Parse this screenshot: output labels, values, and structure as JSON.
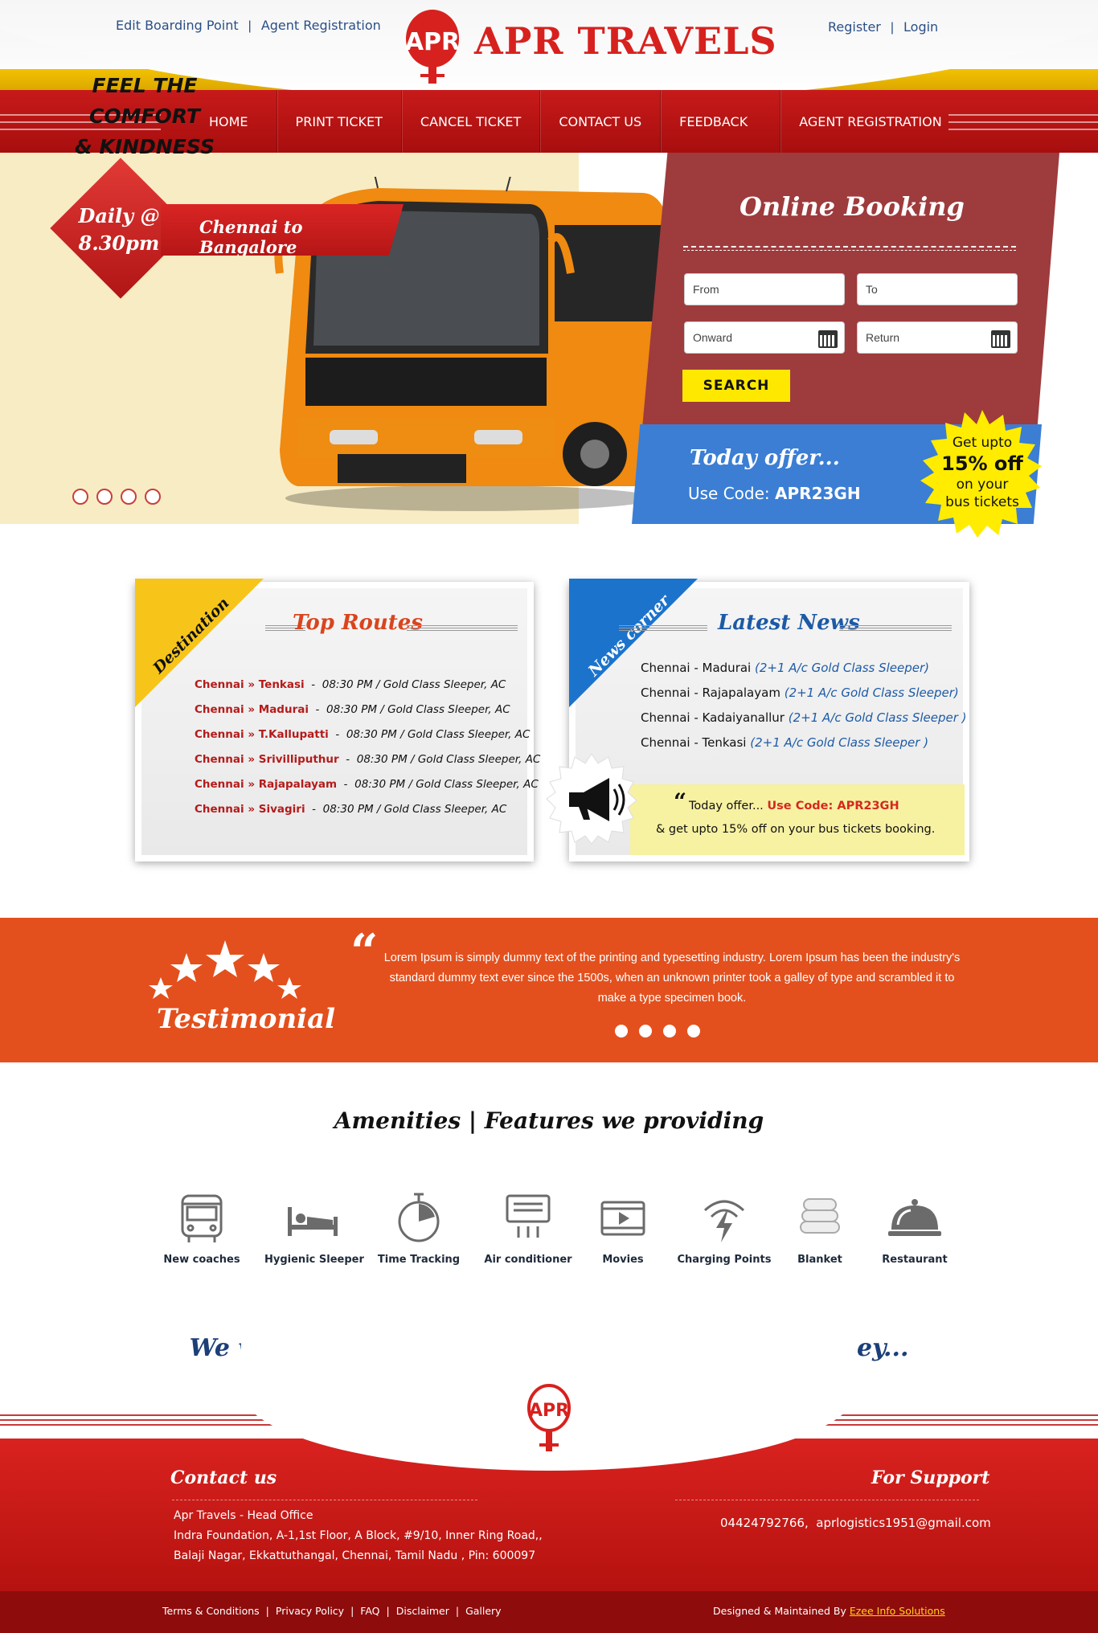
{
  "header": {
    "brand": "APR TRAVELS",
    "logo_text": "APR",
    "top_left_links": [
      "Edit Boarding Point",
      "Agent Registration"
    ],
    "top_right_links": [
      "Register",
      "Login"
    ],
    "separator": "|"
  },
  "nav": {
    "items": [
      "HOME",
      "PRINT TICKET",
      "CANCEL TICKET",
      "CONTACT US",
      "FEEDBACK",
      "AGENT REGISTRATION"
    ]
  },
  "hero": {
    "tagline_1": "FEEL THE COMFORT",
    "tagline_2": "& KINDNESS",
    "daily_1": "Daily @",
    "daily_2": "8.30pm",
    "route": "Chennai to Bangalore",
    "slide_count": 4
  },
  "booking": {
    "title": "Online Booking",
    "from_placeholder": "From",
    "to_placeholder": "To",
    "onward_placeholder": "Onward",
    "return_placeholder": "Return",
    "search_label": "SEARCH"
  },
  "offer": {
    "title": "Today offer...",
    "code_label": "Use Code:",
    "code": "APR23GH",
    "burst_line1": "Get upto",
    "burst_big": "15% off",
    "burst_line2": "on your",
    "burst_line3": "bus tickets"
  },
  "top_routes": {
    "ribbon": "Destination",
    "title": "Top Routes",
    "items": [
      {
        "route": "Chennai » Tenkasi",
        "detail": "08:30 PM / Gold Class Sleeper, AC"
      },
      {
        "route": "Chennai » Madurai",
        "detail": "08:30 PM / Gold Class Sleeper, AC"
      },
      {
        "route": "Chennai » T.Kallupatti",
        "detail": "08:30 PM / Gold Class Sleeper, AC"
      },
      {
        "route": "Chennai » Srivilliputhur",
        "detail": "08:30 PM / Gold Class Sleeper, AC"
      },
      {
        "route": "Chennai » Rajapalayam",
        "detail": "08:30 PM / Gold Class Sleeper, AC"
      },
      {
        "route": "Chennai » Sivagiri",
        "detail": "08:30 PM / Gold Class Sleeper, AC"
      }
    ]
  },
  "latest_news": {
    "ribbon": "News corner",
    "title": "Latest News",
    "items": [
      {
        "route": "Chennai - Madurai",
        "detail": "(2+1 A/c Gold Class Sleeper)"
      },
      {
        "route": "Chennai - Rajapalayam",
        "detail": "(2+1 A/c Gold Class Sleeper)"
      },
      {
        "route": "Chennai - Kadaiyanallur",
        "detail": "(2+1 A/c  Gold Class Sleeper )"
      },
      {
        "route": "Chennai - Tenkasi",
        "detail": "(2+1 A/c Gold Class Sleeper )"
      }
    ],
    "offer_prefix": "Today offer...",
    "offer_code": "Use Code: APR23GH",
    "offer_text": "& get upto 15% off on your bus tickets booking."
  },
  "testimonial": {
    "title": "Testimonial",
    "text": "Lorem Ipsum is simply dummy text of the printing and typesetting industry. Lorem Ipsum has been the industry's standard dummy text ever since the 1500s, when an unknown printer took a galley of type and scrambled it to make a type specimen book.",
    "dot_count": 4
  },
  "amenities": {
    "title": "Amenities | Features we providing",
    "items": [
      {
        "label": "New coaches",
        "icon": "bus-icon"
      },
      {
        "label": "Hygienic Sleeper",
        "icon": "bed-icon"
      },
      {
        "label": "Time Tracking",
        "icon": "stopwatch-icon"
      },
      {
        "label": "Air conditioner",
        "icon": "air-conditioner-icon"
      },
      {
        "label": "Movies",
        "icon": "movie-icon"
      },
      {
        "label": "Charging Points",
        "icon": "charging-icon"
      },
      {
        "label": "Blanket",
        "icon": "blanket-icon"
      },
      {
        "label": "Restaurant",
        "icon": "restaurant-cloche-icon"
      }
    ]
  },
  "wish": "We wish you a very Happy and Comfortable Journey...",
  "footer": {
    "contact_title": "Contact us",
    "support_title": "For Support",
    "address_1": "Apr Travels - Head Office",
    "address_2": "Indra Foundation, A-1,1st Floor, A Block, #9/10, Inner Ring Road,,",
    "address_3": "Balaji Nagar, Ekkattuthangal, Chennai, Tamil Nadu , Pin: 600097",
    "phone": "04424792766,",
    "email": "aprlogistics1951@gmail.com",
    "links": [
      "Terms & Conditions",
      "Privacy Policy",
      "FAQ",
      "Disclaimer",
      "Gallery"
    ],
    "credit_prefix": "Designed & Maintained By",
    "credit_link": "Ezee Info Solutions"
  },
  "colors": {
    "brand_red": "#d7211e",
    "nav_red": "#b71414",
    "gold": "#f2c200",
    "offer_blue": "#3b7ed4",
    "testimonial_orange": "#e3501e",
    "search_yellow": "#ffe800"
  }
}
